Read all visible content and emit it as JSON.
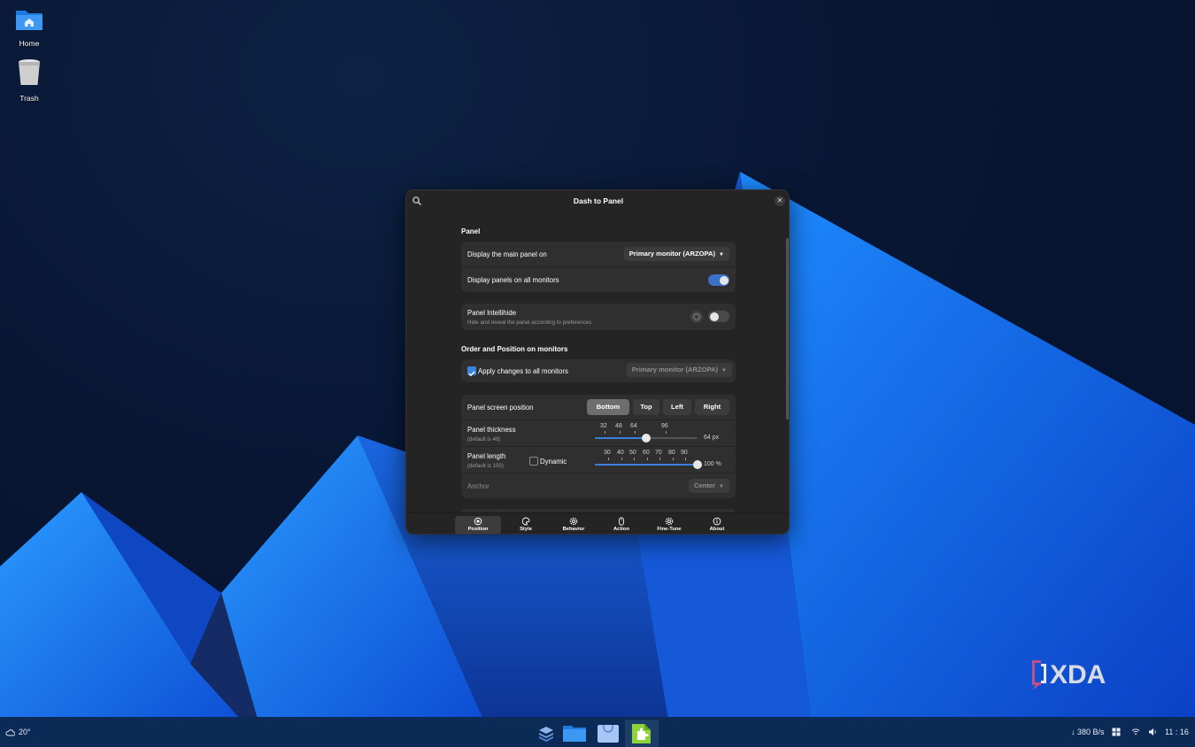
{
  "desktop": {
    "icons": [
      {
        "label": "Home",
        "icon": "home-folder-icon"
      },
      {
        "label": "Trash",
        "icon": "trash-icon"
      }
    ],
    "watermark": "XDA"
  },
  "dialog": {
    "title": "Dash to Panel",
    "panel_section": {
      "title": "Panel",
      "display_main_label": "Display the main panel on",
      "display_main_value": "Primary monitor (ARZOPA)",
      "all_monitors_label": "Display panels on all monitors",
      "all_monitors_on": true,
      "intellihide_label": "Panel Intellihide",
      "intellihide_sub": "Hide and reveal the panel according to preferences",
      "intellihide_on": false
    },
    "order_section": {
      "title": "Order and Position on monitors",
      "apply_all_label": "Apply changes to all monitors",
      "apply_all_checked": true,
      "monitor_value": "Primary monitor (ARZOPA)",
      "position_label": "Panel screen position",
      "position_options": [
        "Bottom",
        "Top",
        "Left",
        "Right"
      ],
      "position_selected": "Bottom",
      "thickness_label": "Panel thickness",
      "thickness_sub": "(default is 48)",
      "thickness_ticks": [
        "32",
        "48",
        "64",
        "96"
      ],
      "thickness_value": "64 px",
      "thickness_level": 64,
      "length_label": "Panel length",
      "length_sub": "(default is 100)",
      "dynamic_label": "Dynamic",
      "dynamic_checked": false,
      "length_ticks": [
        "30",
        "40",
        "50",
        "60",
        "70",
        "80",
        "90"
      ],
      "length_value": "100 %",
      "length_level": 100,
      "anchor_label": "Anchor",
      "anchor_value": "Center"
    },
    "tabs": [
      {
        "label": "Position",
        "icon": "position-icon"
      },
      {
        "label": "Style",
        "icon": "palette-icon"
      },
      {
        "label": "Behavior",
        "icon": "gear-icon"
      },
      {
        "label": "Action",
        "icon": "mouse-icon"
      },
      {
        "label": "Fine-Tune",
        "icon": "tune-gear-icon"
      },
      {
        "label": "About",
        "icon": "info-icon"
      }
    ],
    "active_tab": "Position"
  },
  "taskbar": {
    "weather": "20°",
    "net_speed": "↓ 380 B/s",
    "clock": "11 : 16",
    "apps": [
      "layers-icon",
      "files-icon",
      "store-icon",
      "extensions-icon"
    ]
  },
  "colors": {
    "accent": "#3a7fdc",
    "dialog_bg": "#242424",
    "card_bg": "#2f2f2f",
    "taskbar_bg": "#0b2a55"
  }
}
